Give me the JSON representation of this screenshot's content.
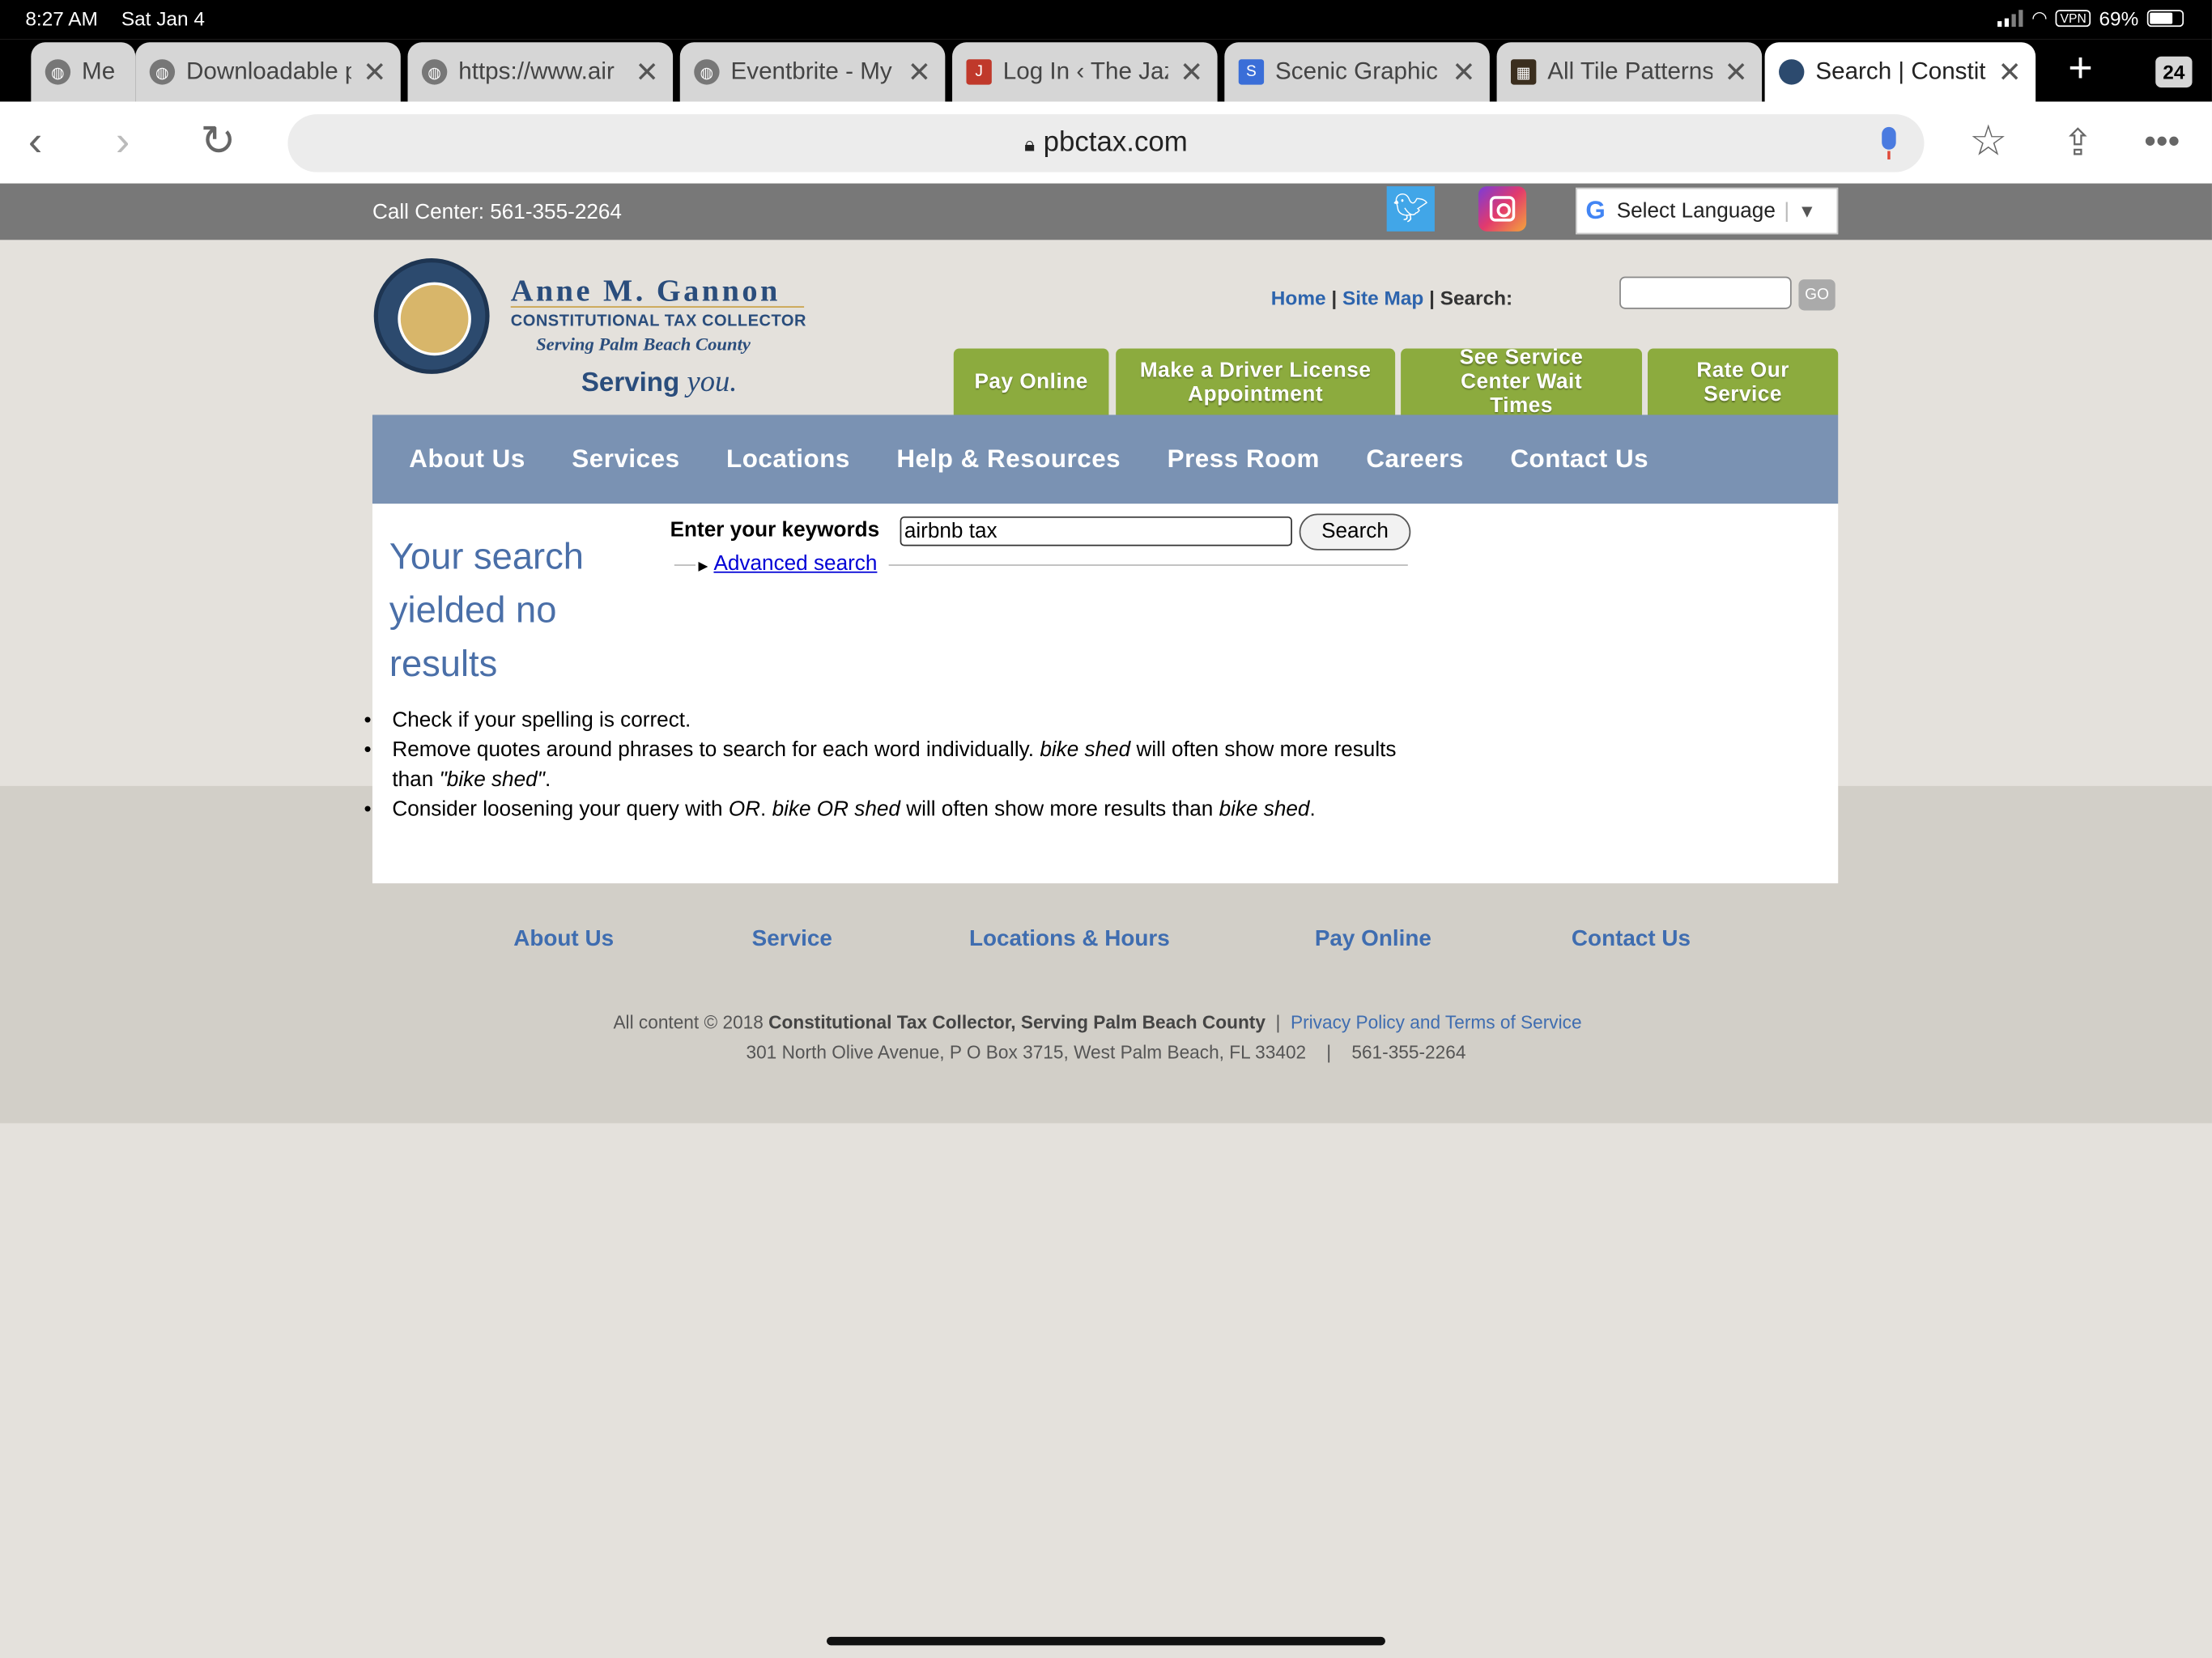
{
  "status_bar": {
    "time": "8:27 AM",
    "date": "Sat Jan 4",
    "vpn": "VPN",
    "battery": "69%"
  },
  "tabs": [
    {
      "title": "Me"
    },
    {
      "title": "Downloadable p"
    },
    {
      "title": "https://www.air"
    },
    {
      "title": "Eventbrite - My"
    },
    {
      "title": "Log In ‹ The Jaz"
    },
    {
      "title": "Scenic Graphic"
    },
    {
      "title": "All Tile Patterns"
    },
    {
      "title": "Search | Constit"
    }
  ],
  "tab_count": "24",
  "url": "pbctax.com",
  "site": {
    "call_center": "Call Center: 561-355-2264",
    "language": "Select Language",
    "logo": {
      "name": "Anne M. Gannon",
      "sub1": "CONSTITUTIONAL TAX COLLECTOR",
      "sub2": "Serving Palm Beach County",
      "serving": "Serving",
      "you": "you."
    },
    "util": {
      "home": "Home",
      "sitemap": "Site Map",
      "search": "Search:",
      "go": "GO"
    },
    "green_buttons": [
      "Pay Online",
      "Make a Driver License Appointment",
      "See Service Center Wait Times",
      "Rate Our Service"
    ],
    "main_nav": [
      "About Us",
      "Services",
      "Locations",
      "Help & Resources",
      "Press Room",
      "Careers",
      "Contact Us"
    ],
    "search": {
      "heading": "Your search yielded no results",
      "keywords_label": "Enter your keywords",
      "keywords_value": "airbnb tax",
      "button": "Search",
      "advanced": "Advanced search"
    },
    "tips": {
      "t1": "Check if your spelling is correct.",
      "t2a": "Remove quotes around phrases to search for each word individually. ",
      "t2b": "bike shed",
      "t2c": " will often show more results than ",
      "t2d": "\"bike shed\"",
      "t2e": ".",
      "t3a": "Consider loosening your query with ",
      "t3b": "OR",
      "t3c": ". ",
      "t3d": "bike OR shed",
      "t3e": " will often show more results than ",
      "t3f": "bike shed",
      "t3g": "."
    },
    "footer": {
      "links": [
        "About Us",
        "Service",
        "Locations & Hours",
        "Pay Online",
        "Contact Us"
      ],
      "copy_prefix": "All content © 2018 ",
      "copy_org": "Constitutional Tax Collector, Serving Palm Beach County",
      "copy_sep": "  |  ",
      "privacy": "Privacy Policy and Terms of Service",
      "address": "301 North Olive Avenue, P O Box 3715, West Palm Beach, FL 33402    |    561-355-2264"
    }
  },
  "colors": {
    "nav_blue": "#7a92b3",
    "green": "#8cab3e",
    "link_blue": "#3f6db0",
    "heading_blue": "#4a6fa8"
  }
}
